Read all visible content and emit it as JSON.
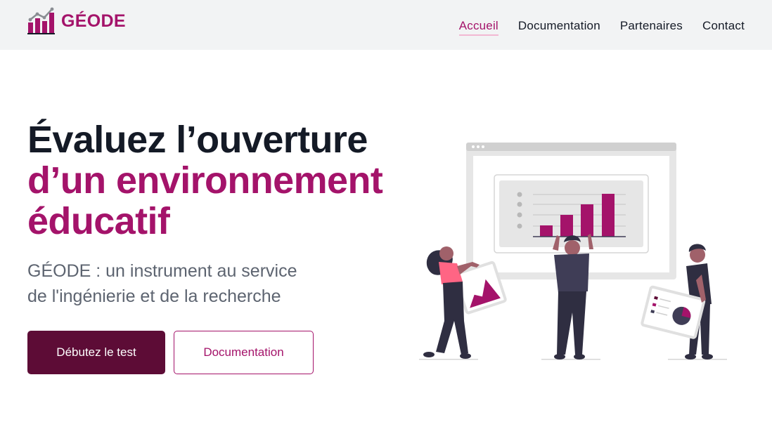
{
  "brand": {
    "name": "GÉODE",
    "logo_icon": "bar-chart-logo-icon"
  },
  "nav": {
    "items": [
      {
        "label": "Accueil",
        "active": true
      },
      {
        "label": "Documentation",
        "active": false
      },
      {
        "label": "Partenaires",
        "active": false
      },
      {
        "label": "Contact",
        "active": false
      }
    ]
  },
  "hero": {
    "title_line1": "Évaluez l’ouverture",
    "title_line2": "d’un environnement",
    "title_line3": "éducatif",
    "subtitle_line1": "GÉODE : un instrument au service",
    "subtitle_line2": "de l'ingénierie et de la recherche",
    "primary_button": "Débutez le test",
    "secondary_button": "Documentation"
  },
  "colors": {
    "accent": "#a4136a",
    "dark_accent": "#5d0c36",
    "text": "#141a26",
    "muted": "#5d6470",
    "navbar_bg": "#f2f3f4",
    "illustration_pink": "#ff6584"
  }
}
